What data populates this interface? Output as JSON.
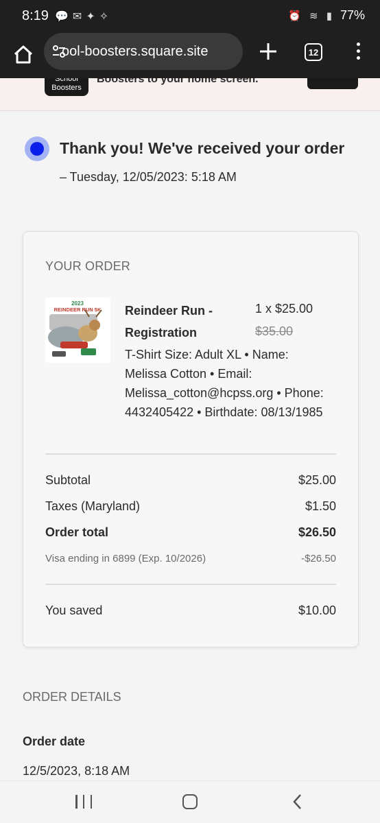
{
  "status_bar": {
    "time": "8:19",
    "battery": "77%"
  },
  "browser": {
    "url": "ool-boosters.square.site",
    "tab_count": "12"
  },
  "banner": {
    "logo_text": "School Boosters",
    "text": "Boosters to your home screen."
  },
  "confirmation": {
    "title": "Thank you! We've received your order",
    "date": "– Tuesday, 12/05/2023: 5:18 AM",
    "accent_color": "#0a20ea"
  },
  "order": {
    "title": "YOUR ORDER",
    "item": {
      "thumb_year": "2023",
      "thumb_label": "REINDEER RUN 5K",
      "name": "Reindeer Run - Registration",
      "qty_price": "1 x $25.00",
      "original_price": "$35.00",
      "details": "T-Shirt Size: Adult XL • Name: Melissa Cotton • Email: Melissa_cotton@hcpss.org • Phone: 4432405422 • Birthdate: 08/13/1985"
    },
    "subtotal_label": "Subtotal",
    "subtotal_value": "$25.00",
    "taxes_label": "Taxes (Maryland)",
    "taxes_value": "$1.50",
    "total_label": "Order total",
    "total_value": "$26.50",
    "payment_label": "Visa ending in 6899 (Exp. 10/2026)",
    "payment_value": "-$26.50",
    "saved_label": "You saved",
    "saved_value": "$10.00"
  },
  "order_details": {
    "title": "ORDER DETAILS",
    "date_label": "Order date",
    "date_value": "12/5/2023, 8:18 AM"
  }
}
